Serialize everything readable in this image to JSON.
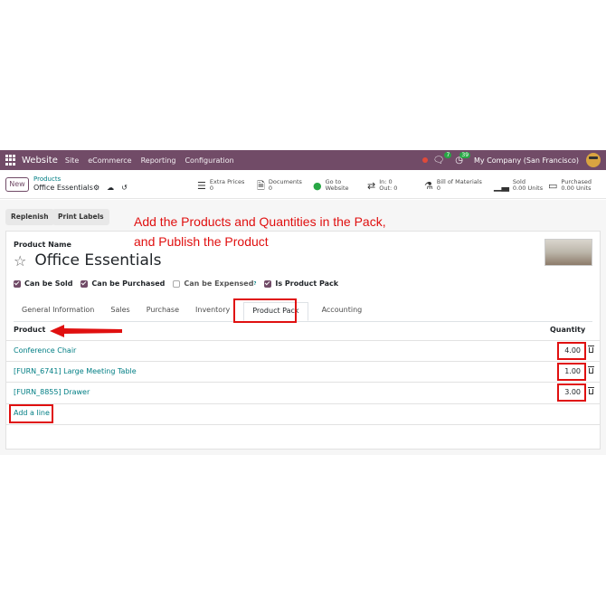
{
  "navbar": {
    "app_name": "Website",
    "menu": [
      "Site",
      "eCommerce",
      "Reporting",
      "Configuration"
    ],
    "messages_count": "7",
    "activity_count": "39",
    "company": "My Company (San Francisco)"
  },
  "control": {
    "new_label": "New",
    "breadcrumb_parent": "Products",
    "breadcrumb_current": "Office Essentials",
    "smart_buttons": [
      {
        "label": "Extra Prices",
        "value": "0",
        "icon": "list-icon"
      },
      {
        "label": "Documents",
        "value": "0",
        "icon": "document-icon"
      },
      {
        "label": "Go to",
        "value": "Website",
        "icon": "globe-icon"
      },
      {
        "label": "In: 0",
        "value": "Out: 0",
        "icon": "exchange-icon"
      },
      {
        "label": "Bill of Materials",
        "value": "0",
        "icon": "flask-icon"
      },
      {
        "label": "Sold",
        "value": "0.00 Units",
        "icon": "bar-chart-icon"
      },
      {
        "label": "Purchased",
        "value": "0.00 Units",
        "icon": "credit-card-icon"
      }
    ]
  },
  "header_buttons": {
    "replenish": "Replenish",
    "print_labels": "Print Labels"
  },
  "annotation": {
    "line1": "Add the Products and Quantities in the Pack,",
    "line2": "and Publish the Product"
  },
  "form": {
    "field_label": "Product Name",
    "product_name": "Office Essentials",
    "checkboxes": [
      {
        "label": "Can be Sold",
        "checked": true
      },
      {
        "label": "Can be Purchased",
        "checked": true
      },
      {
        "label": "Can be Expensed",
        "checked": false,
        "sup": "?"
      },
      {
        "label": "Is Product Pack",
        "checked": true
      }
    ],
    "tabs": [
      "General Information",
      "Sales",
      "Purchase",
      "Inventory",
      "Product Pack",
      "Accounting"
    ],
    "active_tab": "Product Pack"
  },
  "pack_table": {
    "col_product": "Product",
    "col_quantity": "Quantity",
    "rows": [
      {
        "product": "Conference Chair",
        "quantity": "4.00"
      },
      {
        "product": "[FURN_6741] Large Meeting Table",
        "quantity": "1.00"
      },
      {
        "product": "[FURN_8855] Drawer",
        "quantity": "3.00"
      }
    ],
    "add_line": "Add a line"
  },
  "colors": {
    "brand": "#714b67",
    "link": "#017e84",
    "annotation": "#e01010"
  }
}
